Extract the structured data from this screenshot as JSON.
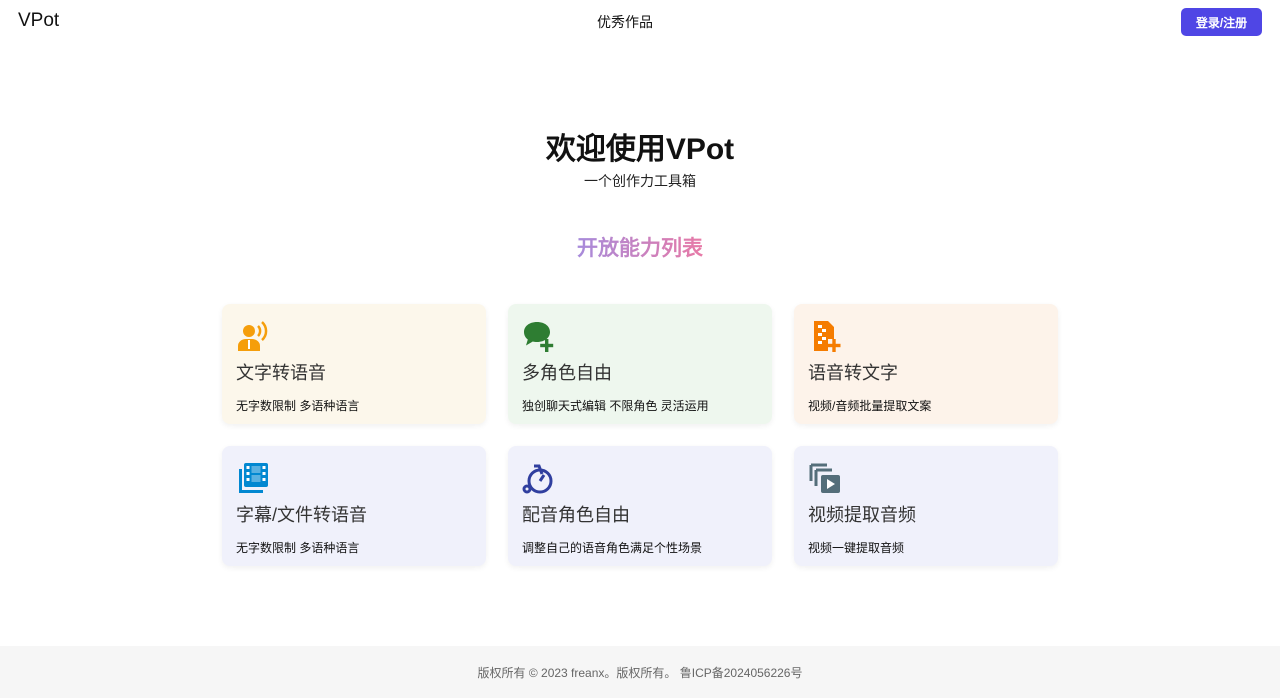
{
  "header": {
    "logo": "VPot",
    "nav_link": "优秀作品",
    "login_label": "登录/注册"
  },
  "hero": {
    "title": "欢迎使用VPot",
    "subtitle": "一个创作力工具箱"
  },
  "section": {
    "title": "开放能力列表",
    "title_gradient": [
      "#a78bdb",
      "#e879a6"
    ]
  },
  "cards": [
    {
      "icon": "speaker-person-icon",
      "icon_color": "#f59e0b",
      "bg": "#fcf7eb",
      "title": "文字转语音",
      "desc": "无字数限制 多语种语言"
    },
    {
      "icon": "chat-add-icon",
      "icon_color": "#2e7d32",
      "bg": "#eef7ee",
      "title": "多角色自由",
      "desc": "独创聊天式编辑 不限角色 灵活运用"
    },
    {
      "icon": "audio-file-add-icon",
      "icon_color": "#f57c00",
      "bg": "#fdf3ea",
      "title": "语音转文字",
      "desc": "视频/音频批量提取文案"
    },
    {
      "icon": "video-library-icon",
      "icon_color": "#0288d1",
      "bg": "#f0f1fb",
      "title": "字幕/文件转语音",
      "desc": "无字数限制 多语种语言"
    },
    {
      "icon": "bicycle-icon",
      "icon_color": "#303f9f",
      "bg": "#f0f1fb",
      "title": "配音角色自由",
      "desc": "调整自己的语音角色满足个性场景"
    },
    {
      "icon": "video-copy-icon",
      "icon_color": "#546e7a",
      "bg": "#f0f1fb",
      "title": "视频提取音频",
      "desc": "视频一键提取音频"
    }
  ],
  "footer": {
    "text": "版权所有 © 2023 freanx。版权所有。 鲁ICP备2024056226号"
  }
}
